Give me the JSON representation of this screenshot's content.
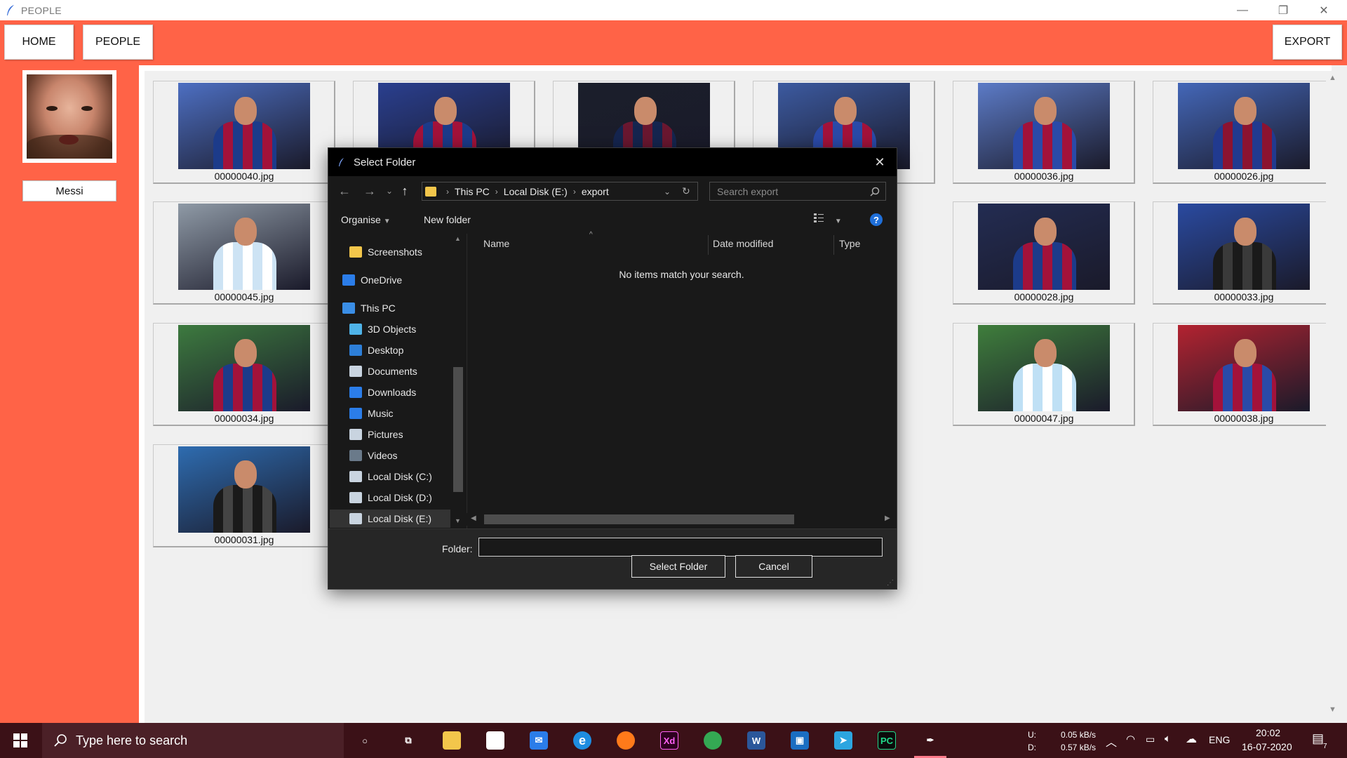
{
  "window": {
    "title": "PEOPLE",
    "minimize": "—",
    "maximize": "❐",
    "close": "✕"
  },
  "toolbar": {
    "home": "HOME",
    "people": "PEOPLE",
    "export": "EXPORT"
  },
  "person": {
    "name": "Messi"
  },
  "grid": [
    {
      "file": "00000040.jpg",
      "kit": "#1c3b8a",
      "stripe": "#a3123a",
      "bg": "#4d6fc2"
    },
    {
      "file": "",
      "kit": "#a3123a",
      "stripe": "#1c3b8a",
      "bg": "#2a3f8f"
    },
    {
      "file": "",
      "kit": "#15254f",
      "stripe": "#6a1730",
      "bg": "#1b1f2b"
    },
    {
      "file": "",
      "kit": "#2a4aa8",
      "stripe": "#a3123a",
      "bg": "#3c5aa0"
    },
    {
      "file": "00000036.jpg",
      "kit": "#2a4aa8",
      "stripe": "#a3123a",
      "bg": "#5c7bc7"
    },
    {
      "file": "00000026.jpg",
      "kit": "#213a8f",
      "stripe": "#8c1330",
      "bg": "#4467b8"
    },
    {
      "file": "00000045.jpg",
      "kit": "#cde3f4",
      "stripe": "#ffffff",
      "bg": "#8f9aa6"
    },
    {
      "file": "00000028.jpg",
      "kit": "#1c3b8a",
      "stripe": "#a3123a",
      "bg": "#232c52"
    },
    {
      "file": "00000033.jpg",
      "kit": "#1a1a1a",
      "stripe": "#3a3a3a",
      "bg": "#2a4aa0"
    },
    {
      "file": "00000034.jpg",
      "kit": "#a3123a",
      "stripe": "#1c3b8a",
      "bg": "#3d7a3f"
    },
    {
      "file": "00000047.jpg",
      "kit": "#bfe0f5",
      "stripe": "#ffffff",
      "bg": "#3f7e3c"
    },
    {
      "file": "00000038.jpg",
      "kit": "#a3123a",
      "stripe": "#2a4aa8",
      "bg": "#b32330"
    },
    {
      "file": "00000031.jpg",
      "kit": "#1a1a1a",
      "stripe": "#444444",
      "bg": "#2e6cb0"
    }
  ],
  "dialog": {
    "title": "Select Folder",
    "close": "✕",
    "nav": {
      "back": "←",
      "forward": "→",
      "recent": "⌄",
      "up": "↑",
      "dropdown": "⌄",
      "refresh": "↻"
    },
    "address": [
      "This PC",
      "Local Disk (E:)",
      "export"
    ],
    "address_sep": "›",
    "search_placeholder": "Search export",
    "organise": "Organise",
    "new_folder": "New folder",
    "help": "?",
    "tree": [
      {
        "label": "Screenshots",
        "icon": "folder-icon",
        "color": "#f3c64b"
      },
      {
        "label": "OneDrive",
        "icon": "cloud-icon",
        "color": "#2b7de9"
      },
      {
        "label": "This PC",
        "icon": "computer-icon",
        "color": "#3a8ee6"
      },
      {
        "label": "3D Objects",
        "icon": "cube-icon",
        "color": "#4fb3e8"
      },
      {
        "label": "Desktop",
        "icon": "desktop-icon",
        "color": "#2d7fd8"
      },
      {
        "label": "Documents",
        "icon": "document-icon",
        "color": "#c9d4e0"
      },
      {
        "label": "Downloads",
        "icon": "download-icon",
        "color": "#2b7de9"
      },
      {
        "label": "Music",
        "icon": "music-icon",
        "color": "#2b7de9"
      },
      {
        "label": "Pictures",
        "icon": "pictures-icon",
        "color": "#c9d4e0"
      },
      {
        "label": "Videos",
        "icon": "video-icon",
        "color": "#6a7a8a"
      },
      {
        "label": "Local Disk (C:)",
        "icon": "drive-icon",
        "color": "#c9d4e0"
      },
      {
        "label": "Local Disk (D:)",
        "icon": "drive-icon",
        "color": "#c9d4e0"
      },
      {
        "label": "Local Disk (E:)",
        "icon": "drive-icon",
        "color": "#c9d4e0"
      }
    ],
    "columns": [
      "Name",
      "Date modified",
      "Type"
    ],
    "empty_message": "No items match your search.",
    "folder_label": "Folder:",
    "folder_value": "",
    "select_button": "Select Folder",
    "cancel_button": "Cancel"
  },
  "taskbar": {
    "search_placeholder": "Type here to search",
    "apps": [
      {
        "name": "cortana-icon",
        "glyph": "○",
        "color": "transparent"
      },
      {
        "name": "task-view-icon",
        "glyph": "⧉",
        "color": "transparent"
      },
      {
        "name": "file-explorer-icon",
        "glyph": "",
        "color": "#f3c64b"
      },
      {
        "name": "store-icon",
        "glyph": "",
        "color": "#ffffff"
      },
      {
        "name": "mail-icon",
        "glyph": "✉",
        "color": "#2b7de9"
      },
      {
        "name": "edge-icon",
        "glyph": "e",
        "color": "#1e8de0"
      },
      {
        "name": "firefox-icon",
        "glyph": "",
        "color": "#ff7a1a"
      },
      {
        "name": "adobe-xd-icon",
        "glyph": "Xd",
        "color": "#2e001f"
      },
      {
        "name": "chrome-icon",
        "glyph": "",
        "color": "#34a853"
      },
      {
        "name": "word-icon",
        "glyph": "W",
        "color": "#2b579a"
      },
      {
        "name": "notes-icon",
        "glyph": "▣",
        "color": "#1b6ec2"
      },
      {
        "name": "telegram-icon",
        "glyph": "➤",
        "color": "#2ca5e0"
      },
      {
        "name": "pycharm-icon",
        "glyph": "PC",
        "color": "#0b0b0b"
      },
      {
        "name": "feather-app-icon",
        "glyph": "✒",
        "color": "transparent"
      }
    ],
    "net_up_label": "U:",
    "net_down_label": "D:",
    "net_up": "0.05 kB/s",
    "net_down": "0.57 kB/s",
    "lang": "ENG",
    "time": "20:02",
    "date": "16-07-2020",
    "notifications": "7"
  }
}
